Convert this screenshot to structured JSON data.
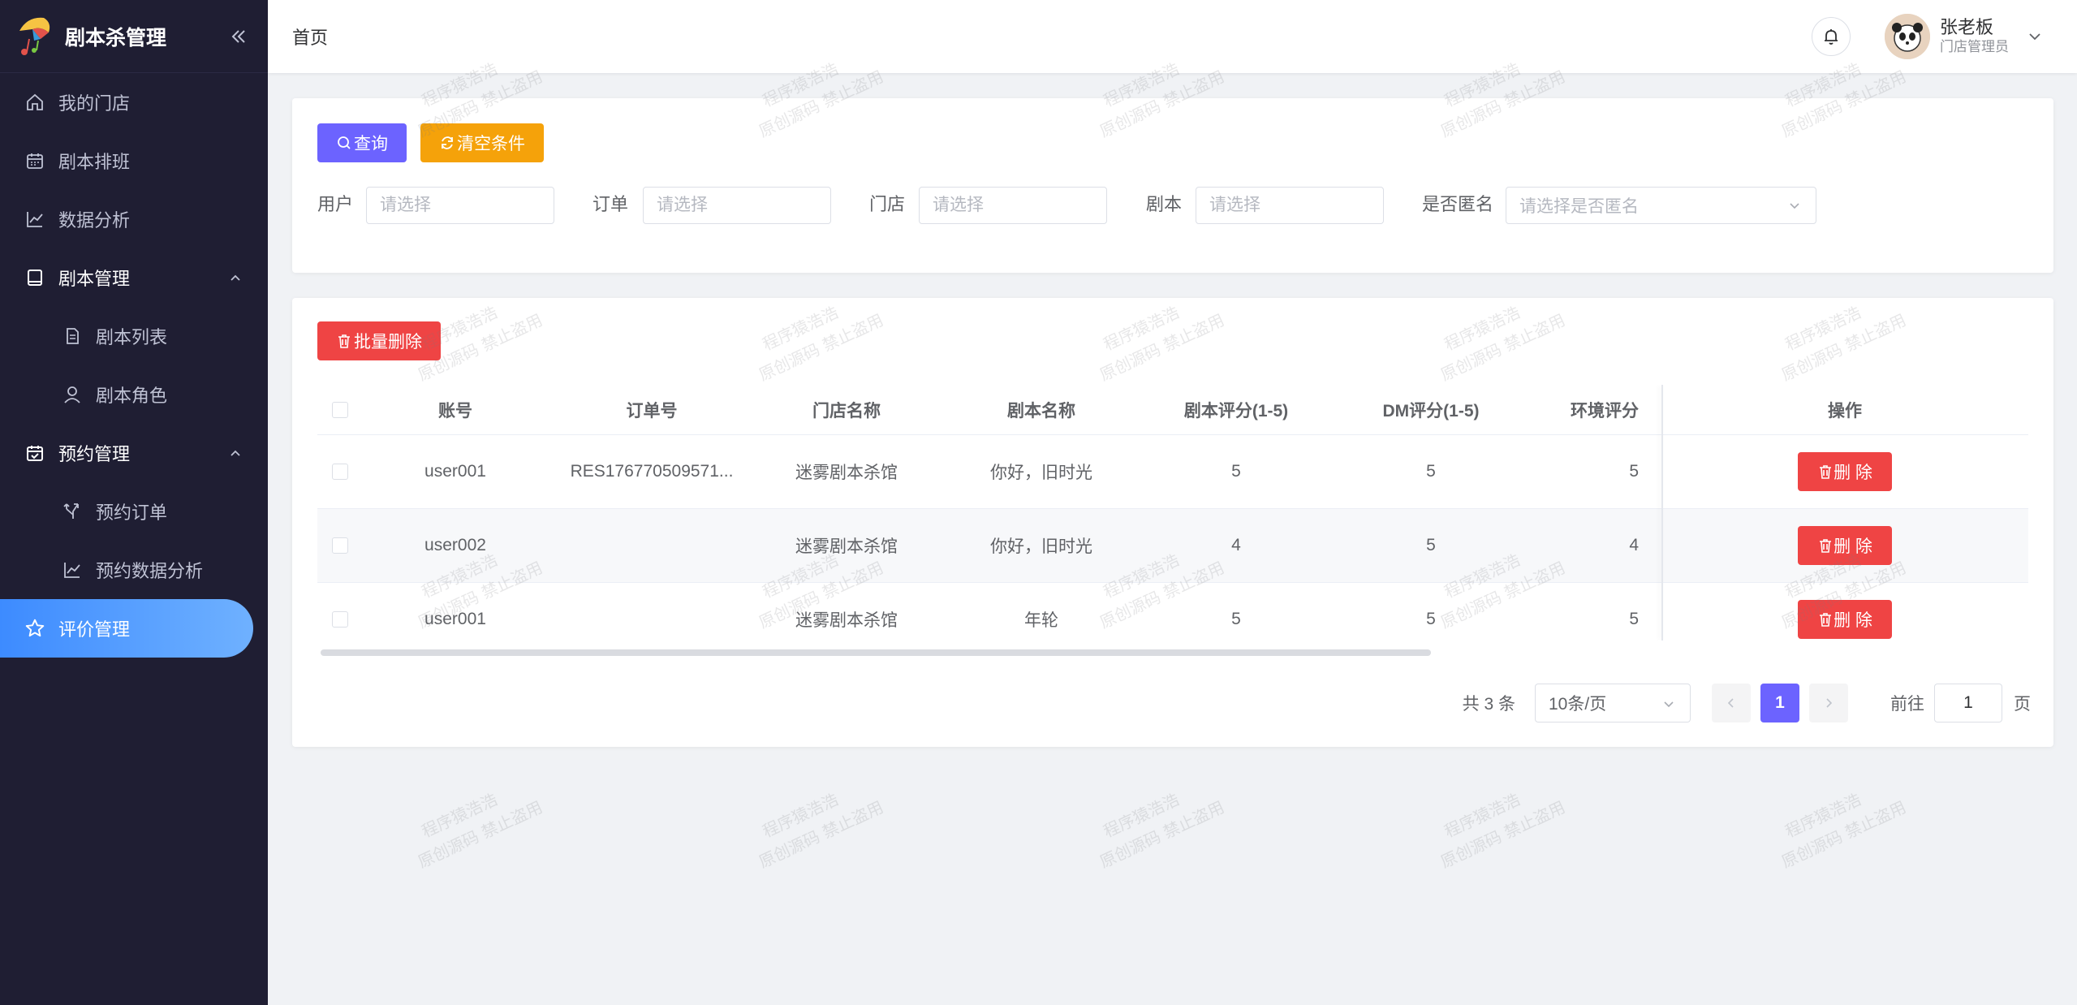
{
  "app": {
    "title": "剧本杀管理",
    "brand_color": "#6c63ff"
  },
  "sidebar": {
    "items": [
      {
        "label": "我的门店",
        "icon": "home-icon"
      },
      {
        "label": "剧本排班",
        "icon": "calendar-icon"
      },
      {
        "label": "数据分析",
        "icon": "chart-line-icon"
      },
      {
        "label": "剧本管理",
        "icon": "book-icon",
        "expanded": true
      },
      {
        "label": "剧本列表",
        "icon": "document-icon"
      },
      {
        "label": "剧本角色",
        "icon": "user-icon"
      },
      {
        "label": "预约管理",
        "icon": "calendar-check-icon",
        "expanded": true
      },
      {
        "label": "预约订单",
        "icon": "fork-icon"
      },
      {
        "label": "预约数据分析",
        "icon": "chart-line-icon"
      },
      {
        "label": "评价管理",
        "icon": "star-icon",
        "active": true
      }
    ]
  },
  "header": {
    "breadcrumb": "首页",
    "user_name": "张老板",
    "user_role": "门店管理员"
  },
  "filter": {
    "query_label": "查询",
    "clear_label": "清空条件",
    "fields": [
      {
        "label": "用户",
        "placeholder": "请选择"
      },
      {
        "label": "订单",
        "placeholder": "请选择"
      },
      {
        "label": "门店",
        "placeholder": "请选择"
      },
      {
        "label": "剧本",
        "placeholder": "请选择"
      },
      {
        "label": "是否匿名",
        "placeholder": "请选择是否匿名"
      }
    ]
  },
  "table": {
    "batch_delete_label": "批量删除",
    "columns": [
      "账号",
      "订单号",
      "门店名称",
      "剧本名称",
      "剧本评分(1-5)",
      "DM评分(1-5)",
      "环境评分",
      "操作"
    ],
    "rows": [
      {
        "account": "user001",
        "order": "RES176770509571...",
        "store": "迷雾剧本杀馆",
        "script": "你好，旧时光",
        "script_score": "5",
        "dm_score": "5",
        "env_score": "5"
      },
      {
        "account": "user002",
        "order": "",
        "store": "迷雾剧本杀馆",
        "script": "你好，旧时光",
        "script_score": "4",
        "dm_score": "5",
        "env_score": "4"
      },
      {
        "account": "user001",
        "order": "",
        "store": "迷雾剧本杀馆",
        "script": "年轮",
        "script_score": "5",
        "dm_score": "5",
        "env_score": "5"
      }
    ],
    "delete_label": "删 除"
  },
  "pagination": {
    "total": "共 3 条",
    "page_size": "10条/页",
    "current": "1",
    "goto_label": "前往",
    "goto_value": "1",
    "unit": "页"
  },
  "watermark": {
    "line1": "程序猿浩浩",
    "line2": "原创源码 禁止盗用"
  }
}
